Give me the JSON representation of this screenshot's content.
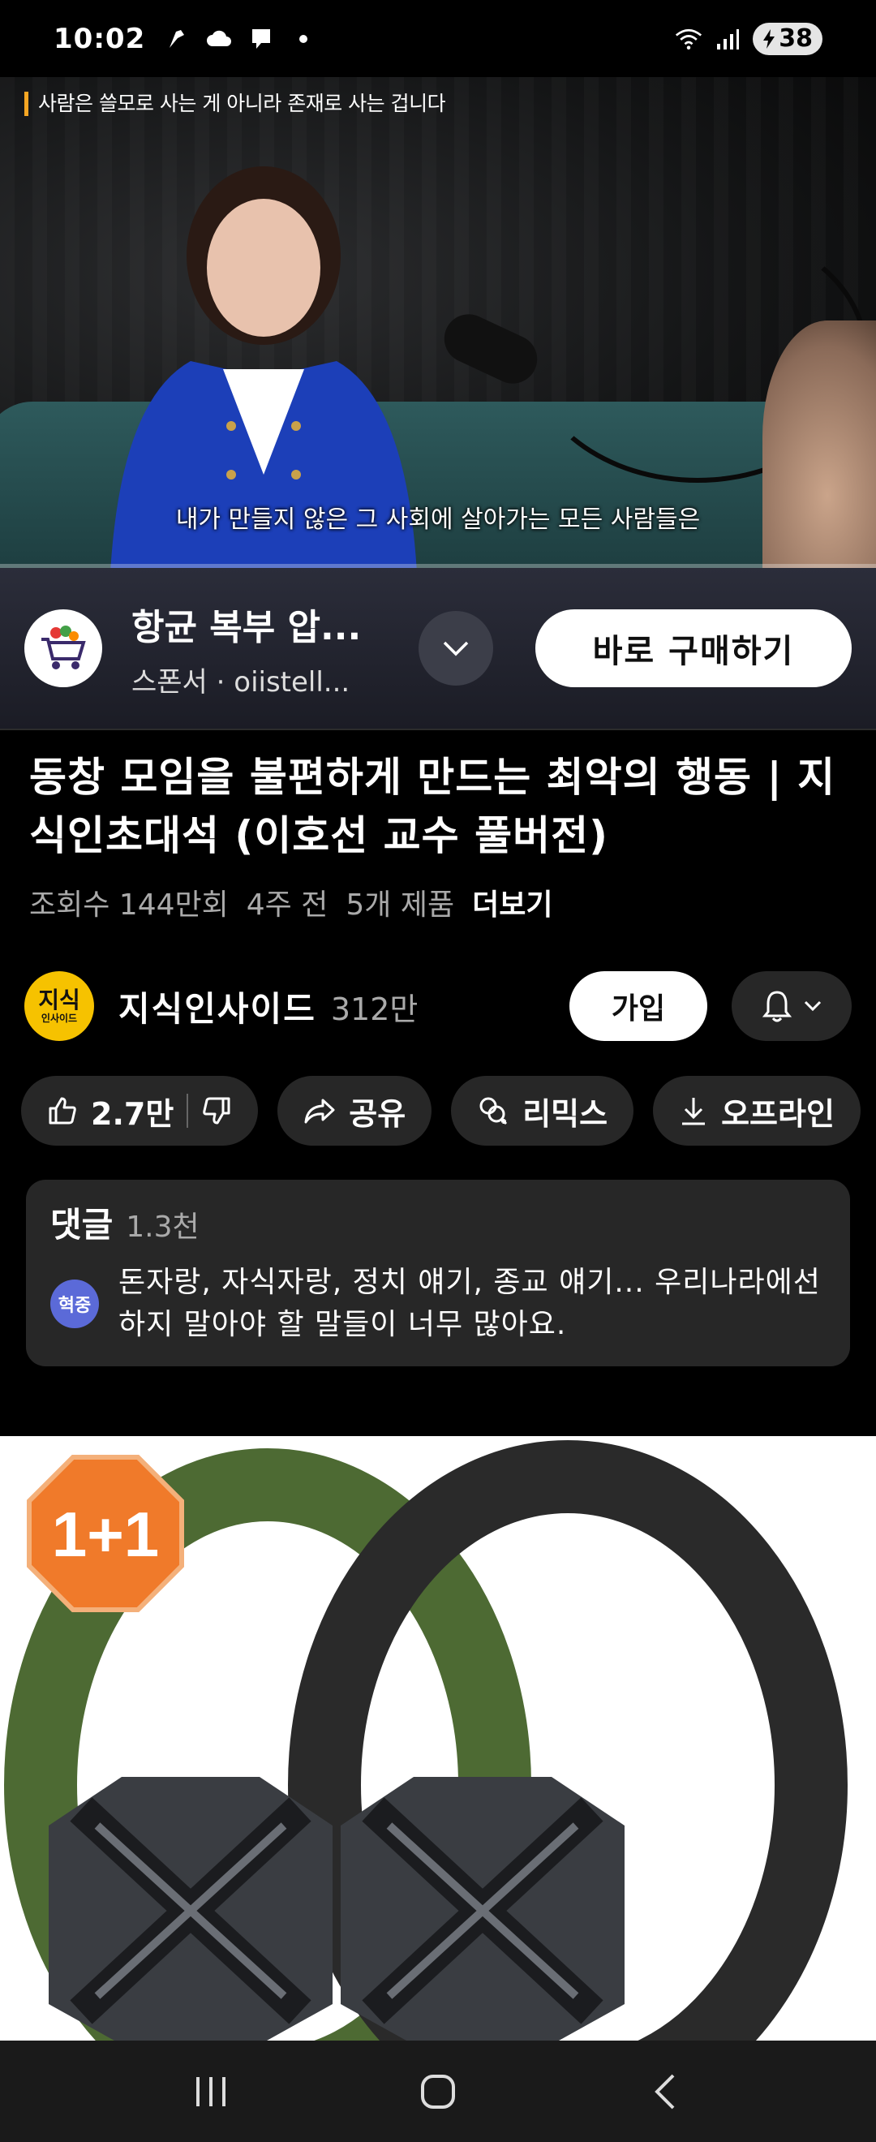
{
  "status_bar": {
    "time": "10:02",
    "battery": "38"
  },
  "video": {
    "headline": "사람은 쓸모로 사는 게 아니라 존재로 사는 겁니다",
    "subtitle": "내가 만들지 않은 그 사회에 살아가는 모든 사람들은",
    "progress_fraction": 0.0
  },
  "sponsor": {
    "title": "항균 복부 압...",
    "subtitle": "스폰서 · oiistell...",
    "buy_label": "바로 구매하기"
  },
  "video_info": {
    "title": "동창 모임을 불편하게 만드는 최악의 행동 | 지식인초대석 (이호선 교수 풀버전)",
    "views": "조회수 144만회",
    "age": "4주 전",
    "products": "5개 제품",
    "more": "더보기"
  },
  "channel": {
    "avatar_line1": "지식",
    "avatar_line2": "인사이드",
    "name": "지식인사이드",
    "subscribers": "312만",
    "join_label": "가입"
  },
  "actions": {
    "like_count": "2.7만",
    "share_label": "공유",
    "remix_label": "리믹스",
    "offline_label": "오프라인"
  },
  "comments": {
    "label": "댓글",
    "count": "1.3천",
    "author_avatar": "혁중",
    "text": "돈자랑, 자식자랑, 정치 얘기, 종교 얘기... 우리나라에선 하지 말아야 할 말들이 너무 많아요."
  },
  "product": {
    "badge": "1+1",
    "colors": {
      "green_belt": "#4d6a33",
      "black_belt": "#2a2a2a",
      "badge": "#f07a2a"
    }
  }
}
